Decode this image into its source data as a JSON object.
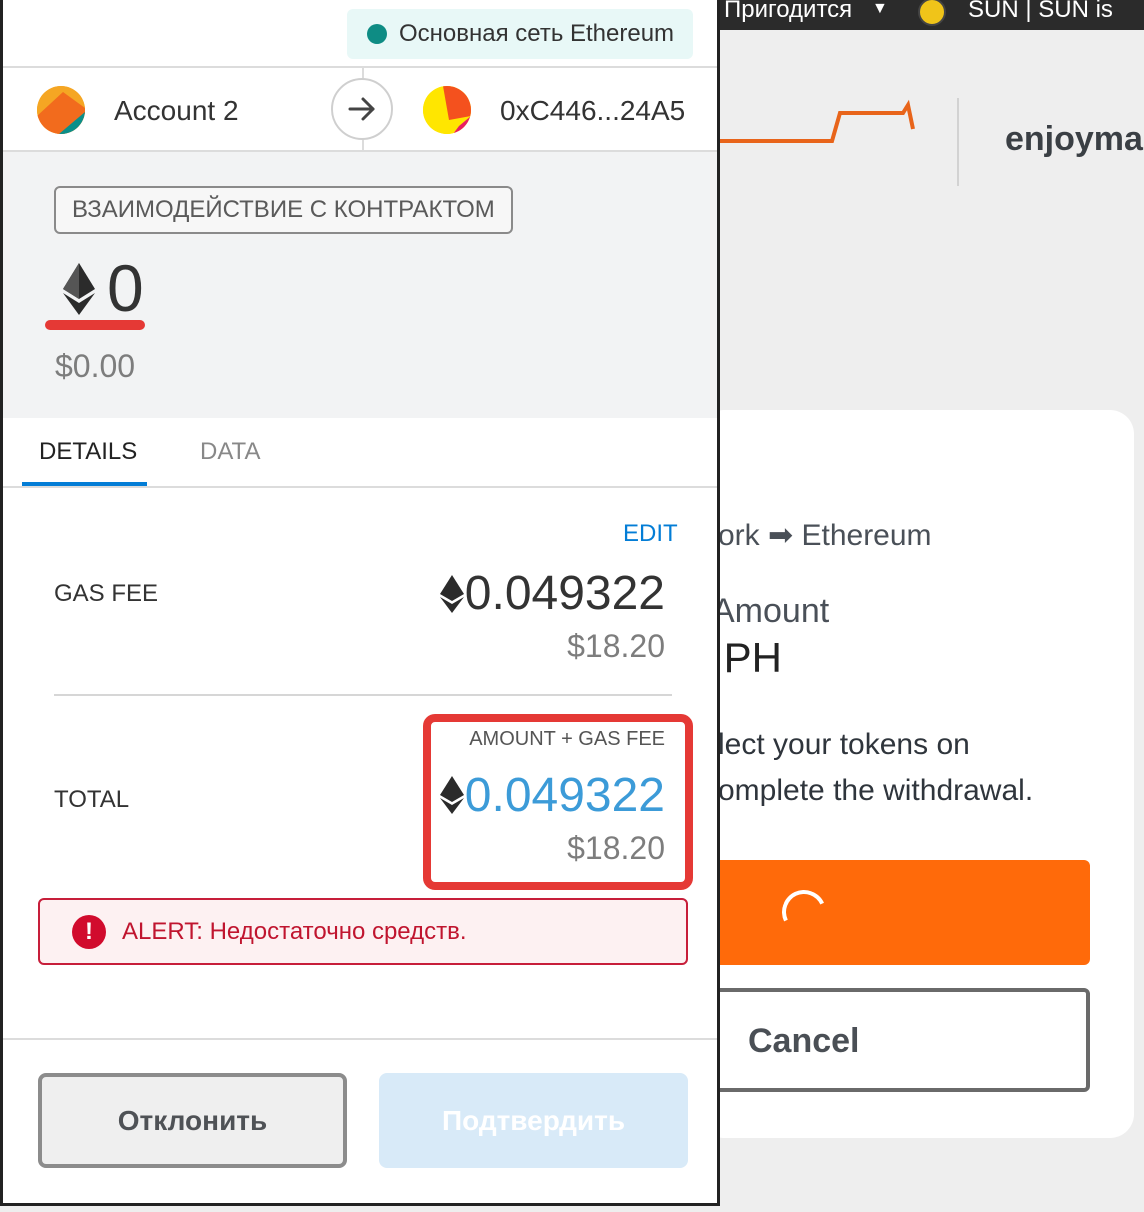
{
  "background_page": {
    "topbar": {
      "bookmark_folder": "Пригодится",
      "bookmark_site": "SUN | SUN is"
    },
    "site_name": "enjoymal",
    "route": "ork ➡ Ethereum",
    "amount_label": "Amount",
    "amount_value": "IPH",
    "message_line1": "lect your tokens on",
    "message_line2": "omplete the withdrawal.",
    "cancel_label": "Cancel",
    "accent_color": "#ff6a0a"
  },
  "popup": {
    "network": {
      "name": "Основная сеть Ethereum",
      "dot_color": "#0e8c84"
    },
    "from_account": {
      "name": "Account 2",
      "avatar_icon": "jazzicon-orange"
    },
    "to_account": {
      "address": "0xC446...24A5",
      "avatar_icon": "jazzicon-yellow"
    },
    "action_badge": "ВЗАИМОДЕЙСТВИЕ С КОНТРАКТОМ",
    "value": {
      "amount": "0",
      "fiat": "$0.00",
      "icon": "eth-icon"
    },
    "tabs": [
      {
        "label": "DETAILS",
        "active": true
      },
      {
        "label": "DATA",
        "active": false
      }
    ],
    "gas": {
      "edit_label": "EDIT",
      "label": "GAS FEE",
      "amount": "0.049322",
      "fiat": "$18.20"
    },
    "total": {
      "label": "TOTAL",
      "caption": "AMOUNT + GAS FEE",
      "amount": "0.049322",
      "fiat": "$18.20"
    },
    "alert": {
      "text": "ALERT: Недостаточно средств.",
      "color": "#c0152f"
    },
    "buttons": {
      "reject": "Отклонить",
      "confirm": "Подтвердить"
    }
  }
}
